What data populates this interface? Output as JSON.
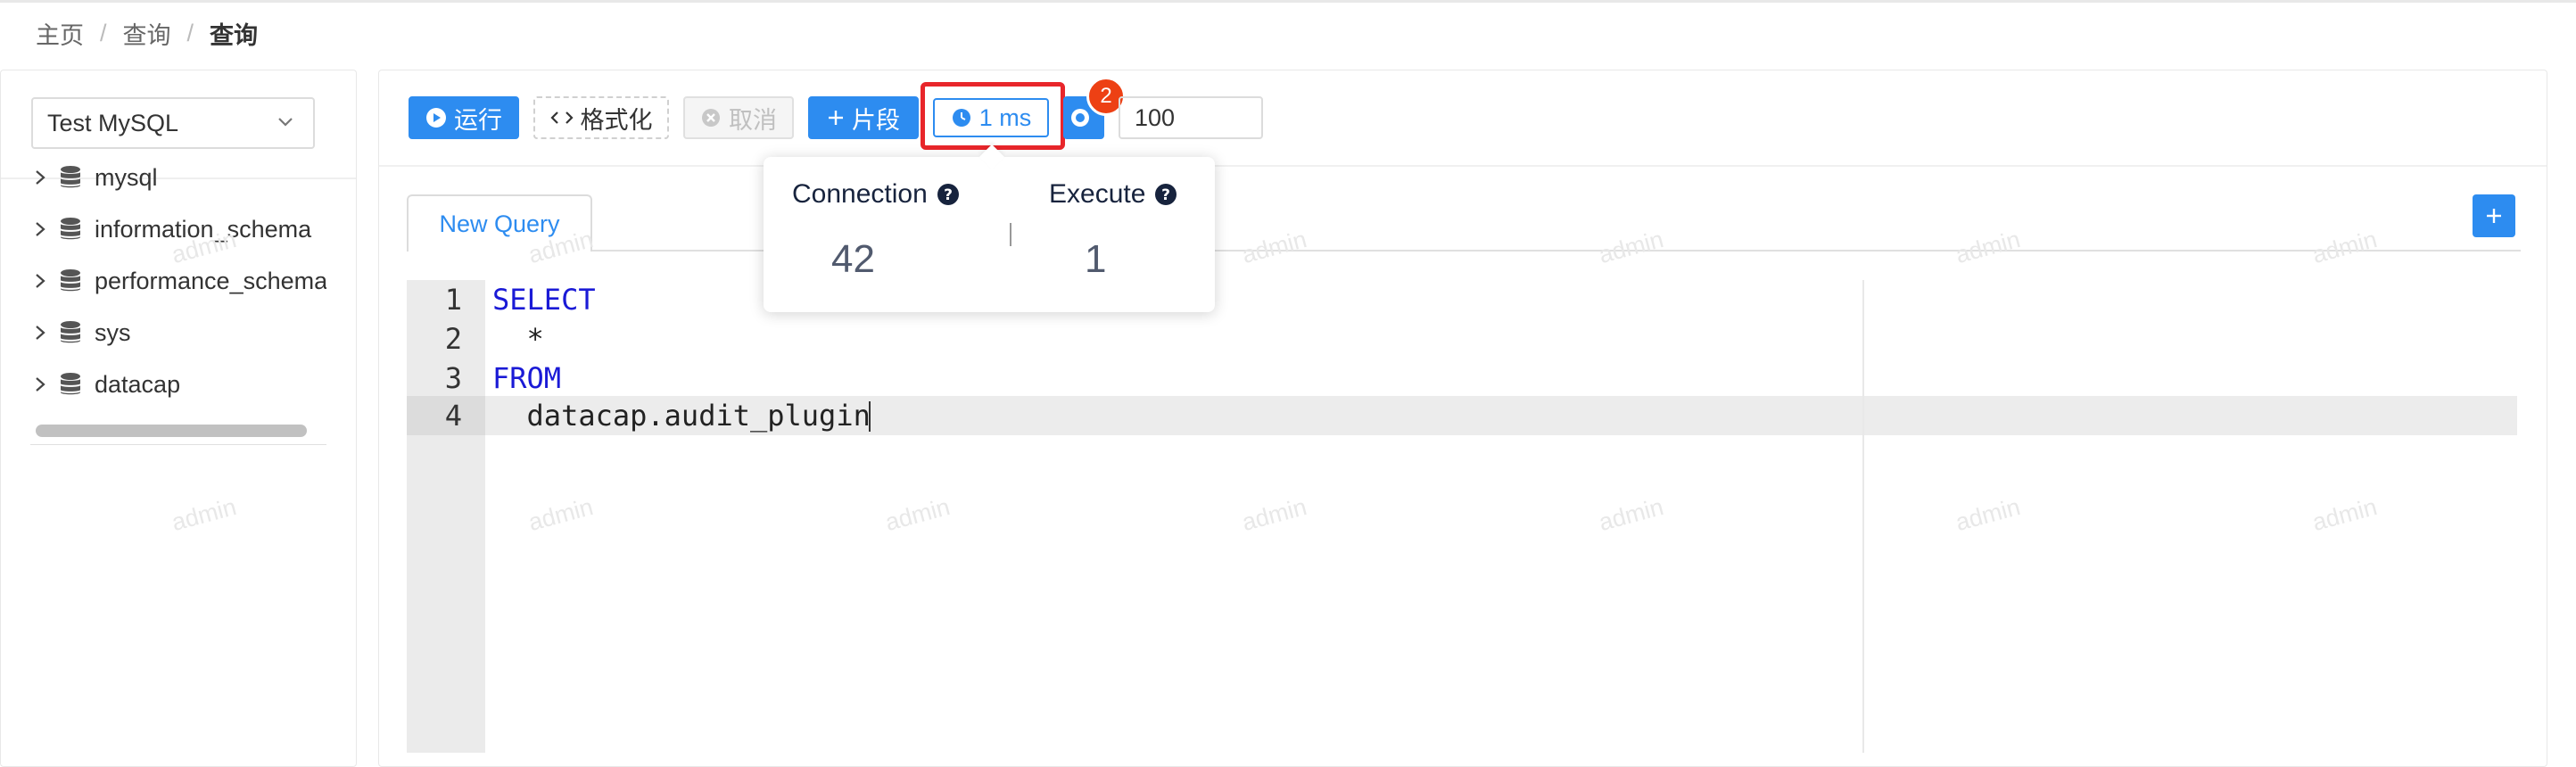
{
  "breadcrumb": {
    "items": [
      "主页",
      "查询",
      "查询"
    ]
  },
  "datasource": {
    "selected": "Test MySQL"
  },
  "tree": {
    "items": [
      {
        "label": "mysql"
      },
      {
        "label": "information_schema"
      },
      {
        "label": "performance_schema"
      },
      {
        "label": "sys"
      },
      {
        "label": "datacap"
      }
    ]
  },
  "toolbar": {
    "run_label": "运行",
    "format_label": "格式化",
    "cancel_label": "取消",
    "snippet_label": "片段",
    "elapsed_label": "1 ms",
    "badge_count": "2",
    "limit_value": "100"
  },
  "popover": {
    "connection_label": "Connection",
    "connection_value": "42",
    "execute_label": "Execute",
    "execute_value": "1"
  },
  "tabs": [
    {
      "label": "New Query"
    }
  ],
  "editor": {
    "lines": [
      {
        "num": "1",
        "text": "SELECT"
      },
      {
        "num": "2",
        "text": "  *"
      },
      {
        "num": "3",
        "text": "FROM"
      },
      {
        "num": "4",
        "text": "  datacap.audit_plugin"
      }
    ],
    "active_line": "4"
  },
  "watermark": {
    "text": "admin"
  },
  "colors": {
    "primary": "#2d8cf0",
    "badge": "#ed4014",
    "highlight": "#e8262b",
    "keyword": "#1a1ad6"
  }
}
